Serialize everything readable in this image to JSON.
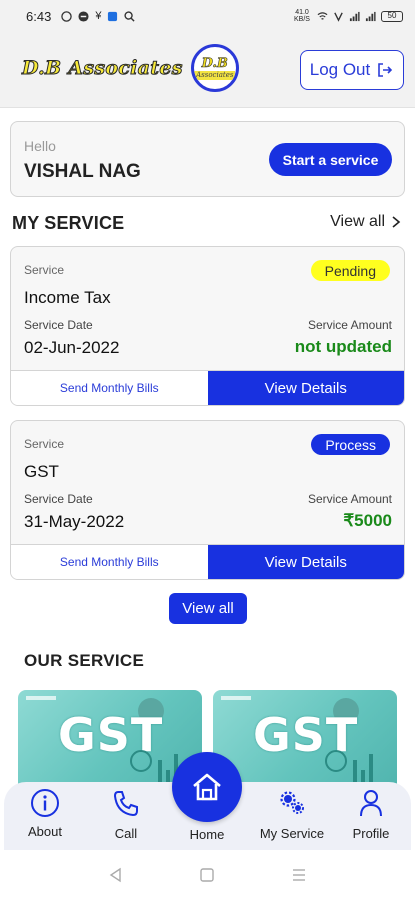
{
  "status_bar": {
    "time": "6:43",
    "network_speed": "41.0 KB/S",
    "battery": "50"
  },
  "header": {
    "logo_text": "D.B Associates",
    "logo_badge_top": "D.B",
    "logo_badge_bottom": "Associates",
    "logout_label": "Log Out"
  },
  "greeting": {
    "hello": "Hello",
    "name": "VISHAL NAG",
    "start_button": "Start a service"
  },
  "my_service": {
    "title": "MY SERVICE",
    "view_all": "View all",
    "cards": [
      {
        "service_label": "Service",
        "service_name": "Income Tax",
        "status": "Pending",
        "date_label": "Service Date",
        "date": "02-Jun-2022",
        "amount_label": "Service Amount",
        "amount": "not updated",
        "bills_button": "Send Monthly Bills",
        "details_button": "View Details"
      },
      {
        "service_label": "Service",
        "service_name": "GST",
        "status": "Process",
        "date_label": "Service Date",
        "date": "31-May-2022",
        "amount_label": "Service Amount",
        "amount": "₹5000",
        "bills_button": "Send Monthly Bills",
        "details_button": "View Details"
      }
    ],
    "view_all_button": "View all"
  },
  "our_service": {
    "title": "OUR SERVICE",
    "banners": [
      "GST",
      "GST"
    ]
  },
  "bottom_nav": {
    "items": [
      {
        "label": "About",
        "icon": "info-icon"
      },
      {
        "label": "Call",
        "icon": "phone-icon"
      },
      {
        "label": "Home",
        "icon": "home-icon"
      },
      {
        "label": "My Service",
        "icon": "gears-icon"
      },
      {
        "label": "Profile",
        "icon": "person-icon"
      }
    ]
  },
  "colors": {
    "primary": "#1831e0",
    "pending_badge": "#ffff1f",
    "amount_green": "#1a8a1a",
    "banner_teal": "#63c4bd"
  }
}
